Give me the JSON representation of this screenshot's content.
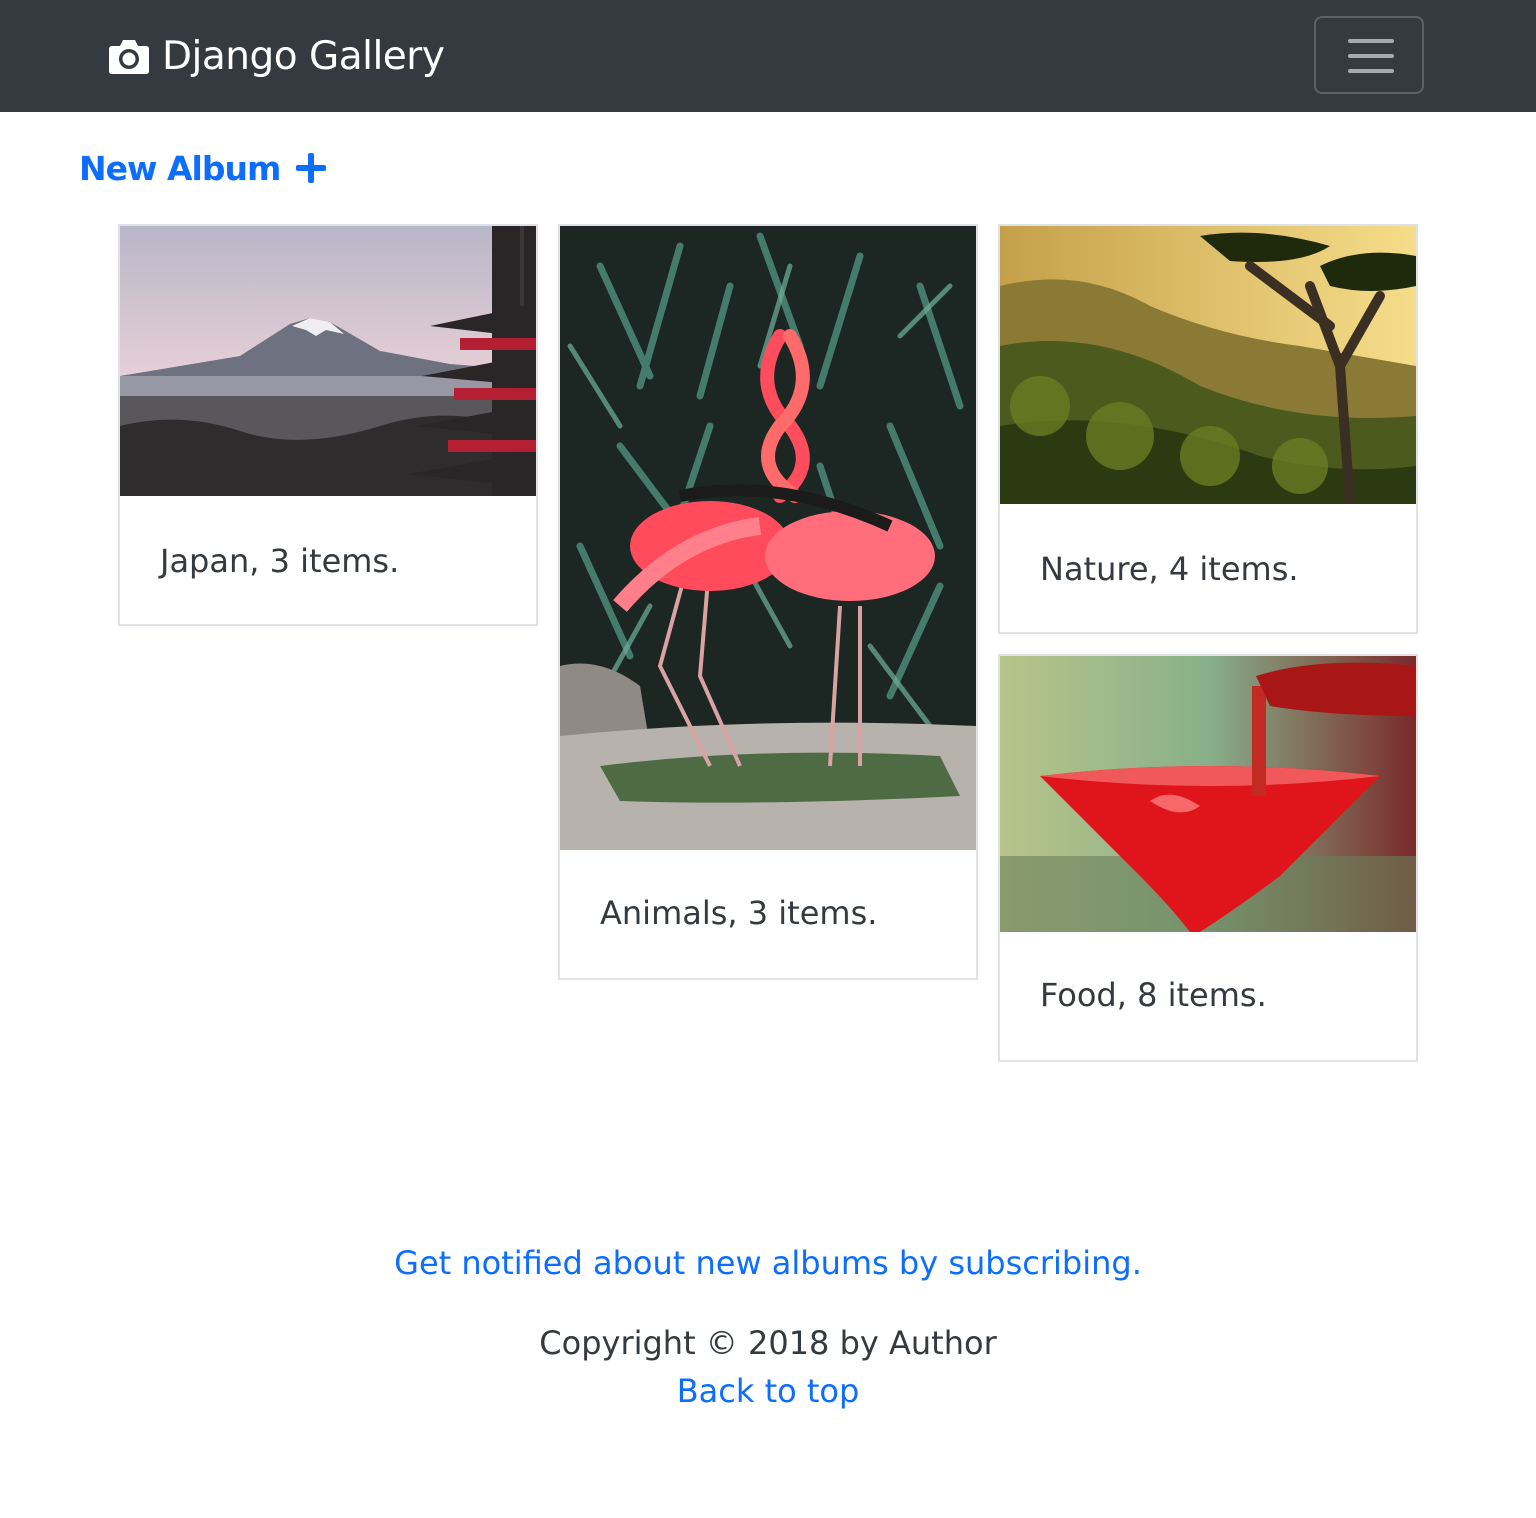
{
  "navbar": {
    "brand": "Django Gallery",
    "brand_icon": "camera-icon",
    "toggler_icon": "hamburger-menu-icon"
  },
  "actions": {
    "new_album_label": "New Album",
    "new_album_icon": "plus-icon"
  },
  "albums": [
    {
      "caption": "Japan, 3 items.",
      "image": "mount-fuji-pagoda"
    },
    {
      "caption": "Animals, 3 items.",
      "image": "flamingos"
    },
    {
      "caption": "Nature, 4 items.",
      "image": "forest-sunset"
    },
    {
      "caption": "Food, 8 items.",
      "image": "red-cocktail"
    }
  ],
  "footer": {
    "subscribe_link": "Get notified about new albums by subscribing.",
    "copyright": "Copyright © 2018 by Author",
    "back_to_top": "Back to top"
  },
  "colors": {
    "navbar_bg": "#343a40",
    "link": "#0d6efd",
    "card_border": "#dee2e6"
  }
}
